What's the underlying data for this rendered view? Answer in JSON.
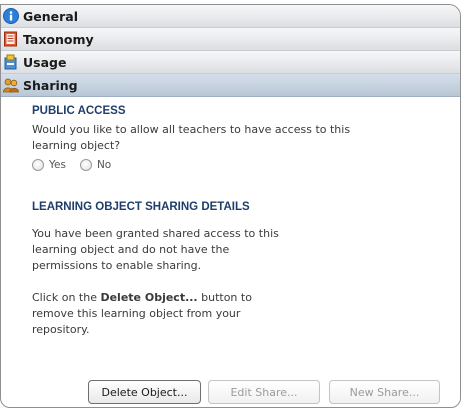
{
  "accordion": {
    "sections": [
      {
        "label": "General",
        "icon": "info-icon"
      },
      {
        "label": "Taxonomy",
        "icon": "taxonomy-icon"
      },
      {
        "label": "Usage",
        "icon": "usage-icon"
      },
      {
        "label": "Sharing",
        "icon": "sharing-icon"
      }
    ],
    "active_section": "Sharing"
  },
  "sharing": {
    "public_access": {
      "title": "PUBLIC ACCESS",
      "question_line1": "Would you like to allow all teachers to have access to this",
      "question_line2": "learning object?",
      "options": [
        "Yes",
        "No"
      ]
    },
    "details": {
      "title": "LEARNING OBJECT SHARING DETAILS",
      "para1_line1": "You have been granted shared access to this",
      "para1_line2": "learning object and do not have the",
      "para1_line3": "permissions to enable sharing.",
      "para2_prefix": "Click on the ",
      "para2_bold": "Delete Object...",
      "para2_suffix": " button to",
      "para2_line2": "remove this learning object from your",
      "para2_line3": "repository."
    }
  },
  "buttons": {
    "delete": "Delete Object...",
    "edit_share": "Edit Share...",
    "new_share": "New Share..."
  },
  "colors": {
    "section_title": "#1f3e6a",
    "active_header": "#c7d3e0"
  }
}
